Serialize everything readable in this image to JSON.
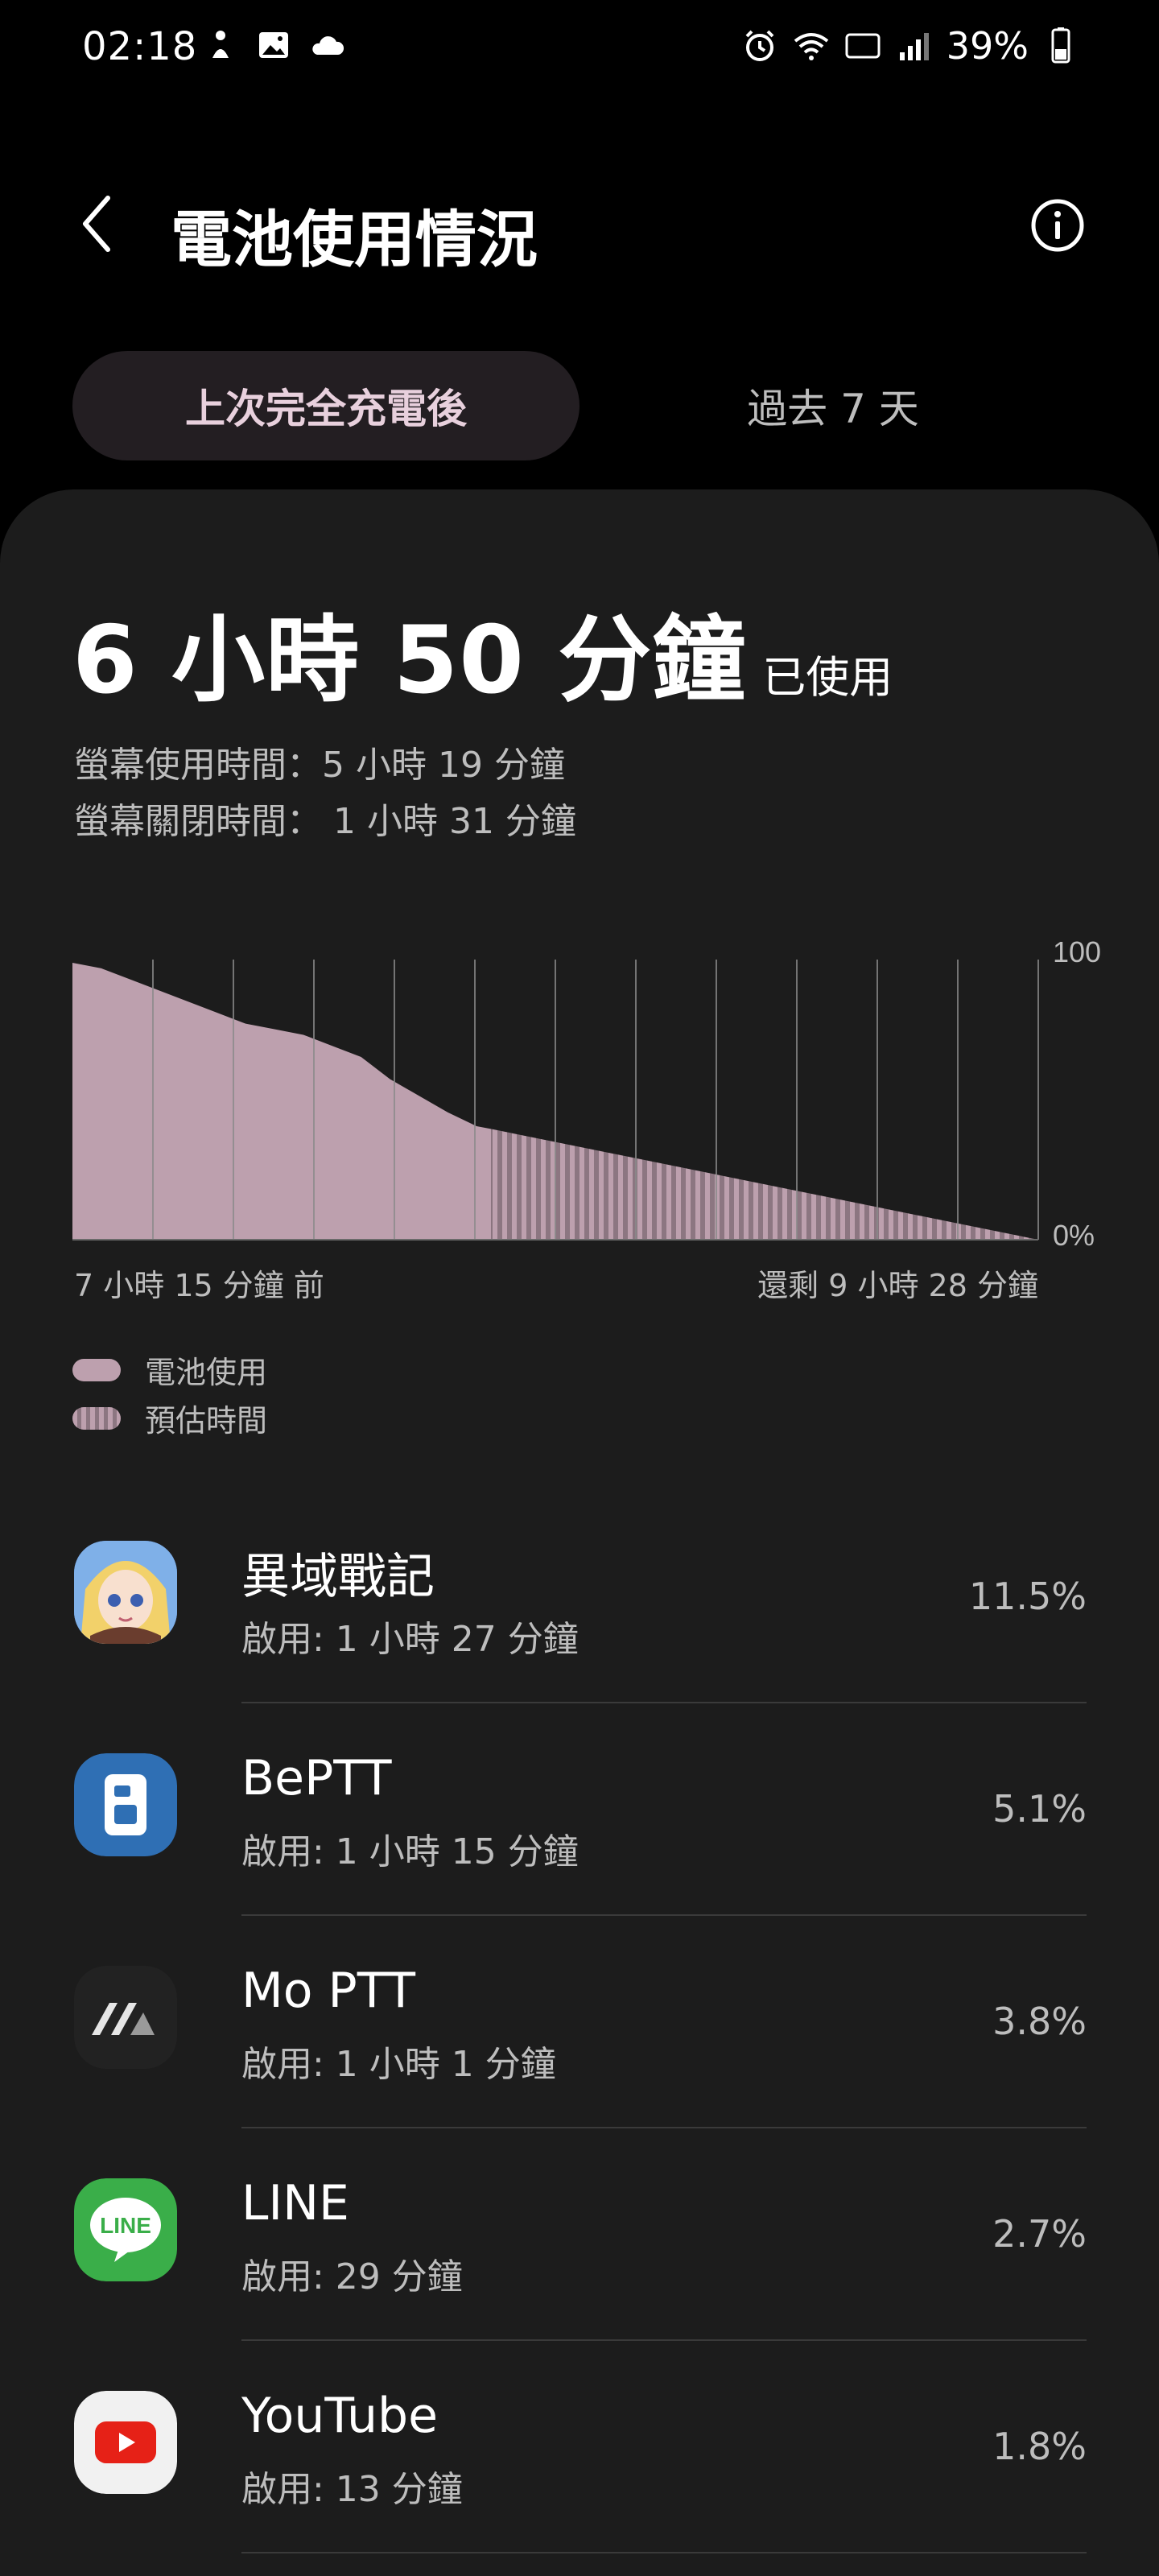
{
  "status_bar": {
    "time": "02:18",
    "battery_percent": "39%",
    "left_icons": [
      "figure-icon",
      "image-icon",
      "cloud-icon"
    ],
    "right_icons": [
      "alarm-icon",
      "wifi-icon",
      "volte-icon",
      "signal-icon",
      "battery-icon"
    ]
  },
  "header": {
    "title": "電池使用情況"
  },
  "tabs": [
    {
      "label": "上次完全充電後",
      "selected": true
    },
    {
      "label": "過去 7 天",
      "selected": false
    }
  ],
  "summary": {
    "total_used": "6 小時 50 分鐘",
    "total_used_suffix": "已使用",
    "screen_on": "螢幕使用時間：5 小時 19 分鐘",
    "screen_off": "螢幕關閉時間： 1 小時 31 分鐘"
  },
  "chart_data": {
    "type": "area",
    "y_max_label": "100",
    "y_min_label": "0%",
    "ylim": [
      0,
      100
    ],
    "x_start_label": "7 小時 15 分鐘 前",
    "x_end_label": "還剩 9 小時 28 分鐘",
    "series": [
      {
        "name": "電池使用",
        "x_hours": [
          0,
          0.5,
          1,
          1.5,
          2,
          2.5,
          3,
          3.5,
          4,
          4.5,
          5,
          5.5,
          6,
          6.5,
          7,
          7.25
        ],
        "values": [
          100,
          98,
          94,
          90,
          86,
          82,
          78,
          76,
          74,
          70,
          66,
          58,
          52,
          46,
          41,
          40
        ]
      },
      {
        "name": "預估時間",
        "x_hours": [
          7.25,
          16.73
        ],
        "values": [
          40,
          0
        ]
      }
    ],
    "grid": "vertical",
    "colors": {
      "used": "#bda0ae",
      "estimated": "#8c7681",
      "grid": "#8a8a8a"
    }
  },
  "legend": {
    "used_label": "電池使用",
    "estimated_label": "預估時間"
  },
  "apps": [
    {
      "name": "異域戰記",
      "usage": "啟用: 1 小時 27 分鐘",
      "percent": "11.5%",
      "icon": "game-character-icon"
    },
    {
      "name": "BePTT",
      "usage": "啟用: 1 小時 15 分鐘",
      "percent": "5.1%",
      "icon": "beptt-icon"
    },
    {
      "name": "Mo PTT",
      "usage": "啟用: 1 小時 1 分鐘",
      "percent": "3.8%",
      "icon": "moptt-icon"
    },
    {
      "name": "LINE",
      "usage": "啟用: 29 分鐘",
      "percent": "2.7%",
      "icon": "line-icon"
    },
    {
      "name": "YouTube",
      "usage": "啟用: 13 分鐘",
      "percent": "1.8%",
      "icon": "youtube-icon"
    }
  ],
  "icon_labels": {
    "line_text": "LINE"
  }
}
